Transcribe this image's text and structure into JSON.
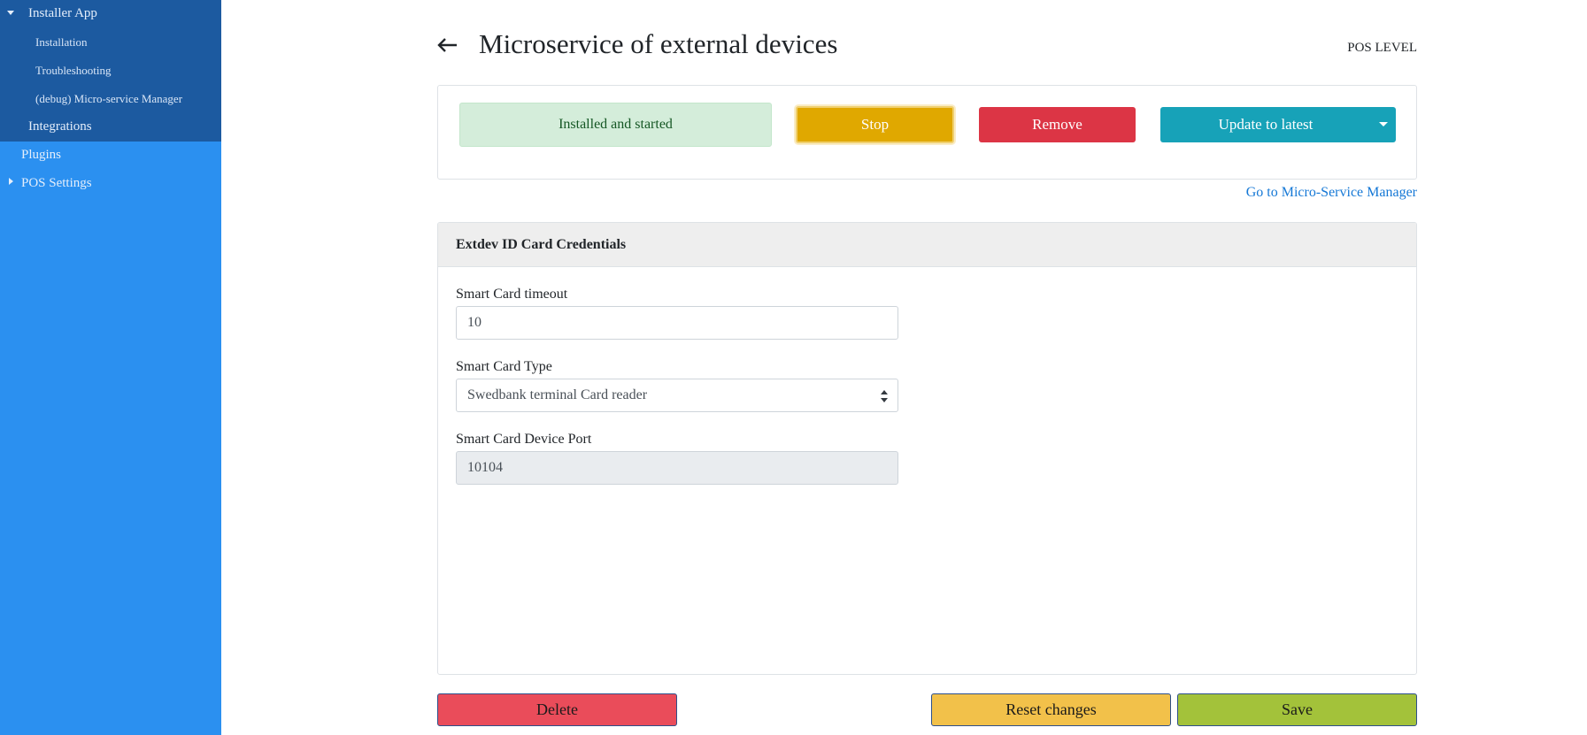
{
  "sidebar": {
    "installer_app": "Installer App",
    "installation": "Installation",
    "troubleshooting": "Troubleshooting",
    "debug_manager": "(debug) Micro-service Manager",
    "integrations": "Integrations",
    "plugins": "Plugins",
    "pos_settings": "POS Settings"
  },
  "header": {
    "back_icon": "arrow-left-icon",
    "title": "Microservice of external devices",
    "level": "POS LEVEL"
  },
  "status": {
    "badge": "Installed and started",
    "stop_label": "Stop",
    "remove_label": "Remove",
    "update_label": "Update to latest"
  },
  "link": {
    "manager": "Go to Micro-Service Manager"
  },
  "config": {
    "title": "Extdev ID Card Credentials",
    "timeout_label": "Smart Card timeout",
    "timeout_value": "10",
    "type_label": "Smart Card Type",
    "type_value": "Swedbank terminal Card reader",
    "port_label": "Smart Card Device Port",
    "port_value": "10104"
  },
  "footer": {
    "delete_label": "Delete",
    "reset_label": "Reset changes",
    "save_label": "Save"
  },
  "colors": {
    "sidebar_bg": "#2b90f0",
    "sidebar_group_bg": "#1c5aa0",
    "success_bg": "#d4edda",
    "warning": "#e0a800",
    "danger": "#dc3545",
    "info": "#17a2b8",
    "link": "#1578d6",
    "save": "#a3c23a"
  }
}
